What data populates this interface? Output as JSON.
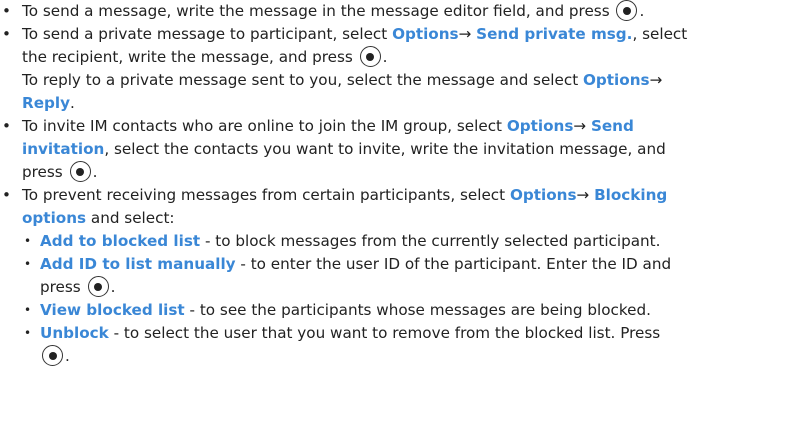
{
  "items": [
    {
      "lines": [
        [
          "To send a message, write the message in the message editor field, and press ",
          "KEY",
          "."
        ]
      ]
    },
    {
      "lines": [
        [
          "To send a private message to participant, select ",
          {
            "hl": "Options"
          },
          "ARROW",
          {
            "hl": "Send private msg."
          },
          ", select"
        ],
        [
          "the recipient, write the message, and press ",
          "KEY",
          "."
        ],
        [
          "To reply to a private message sent to you, select the message and select ",
          {
            "hl": "Options"
          },
          "ARROW"
        ],
        [
          {
            "hl": "Reply"
          },
          "."
        ]
      ]
    },
    {
      "lines": [
        [
          "To invite IM contacts who are online to join the IM group, select ",
          {
            "hl": "Options"
          },
          "ARROW",
          {
            "hl": "Send"
          }
        ],
        [
          {
            "hl": "invitation"
          },
          ", select the contacts you want to invite, write the invitation message, and"
        ],
        [
          "press ",
          "KEY",
          "."
        ]
      ]
    },
    {
      "lines": [
        [
          "To prevent receiving messages from certain participants, select ",
          {
            "hl": "Options"
          },
          "ARROW",
          {
            "hl": "Blocking"
          }
        ],
        [
          {
            "hl": "options"
          },
          " and select:"
        ]
      ],
      "subitems": [
        {
          "lines": [
            [
              {
                "hl": "Add to blocked list"
              },
              " - to block messages from the currently selected participant."
            ]
          ]
        },
        {
          "lines": [
            [
              {
                "hl": "Add ID to list manually"
              },
              " - to enter the user ID of the participant. Enter the ID and"
            ],
            [
              "press ",
              "KEY",
              "."
            ]
          ]
        },
        {
          "lines": [
            [
              {
                "hl": "View blocked list"
              },
              " - to see the participants whose messages are being blocked."
            ]
          ]
        },
        {
          "lines": [
            [
              {
                "hl": "Unblock"
              },
              " - to select the user that you want to remove from the blocked list. Press"
            ],
            [
              "KEY",
              "."
            ]
          ]
        }
      ]
    }
  ],
  "bullet_symbol": "•",
  "arrow_symbol": "→",
  "icons": {
    "key": "selection-key-icon"
  }
}
